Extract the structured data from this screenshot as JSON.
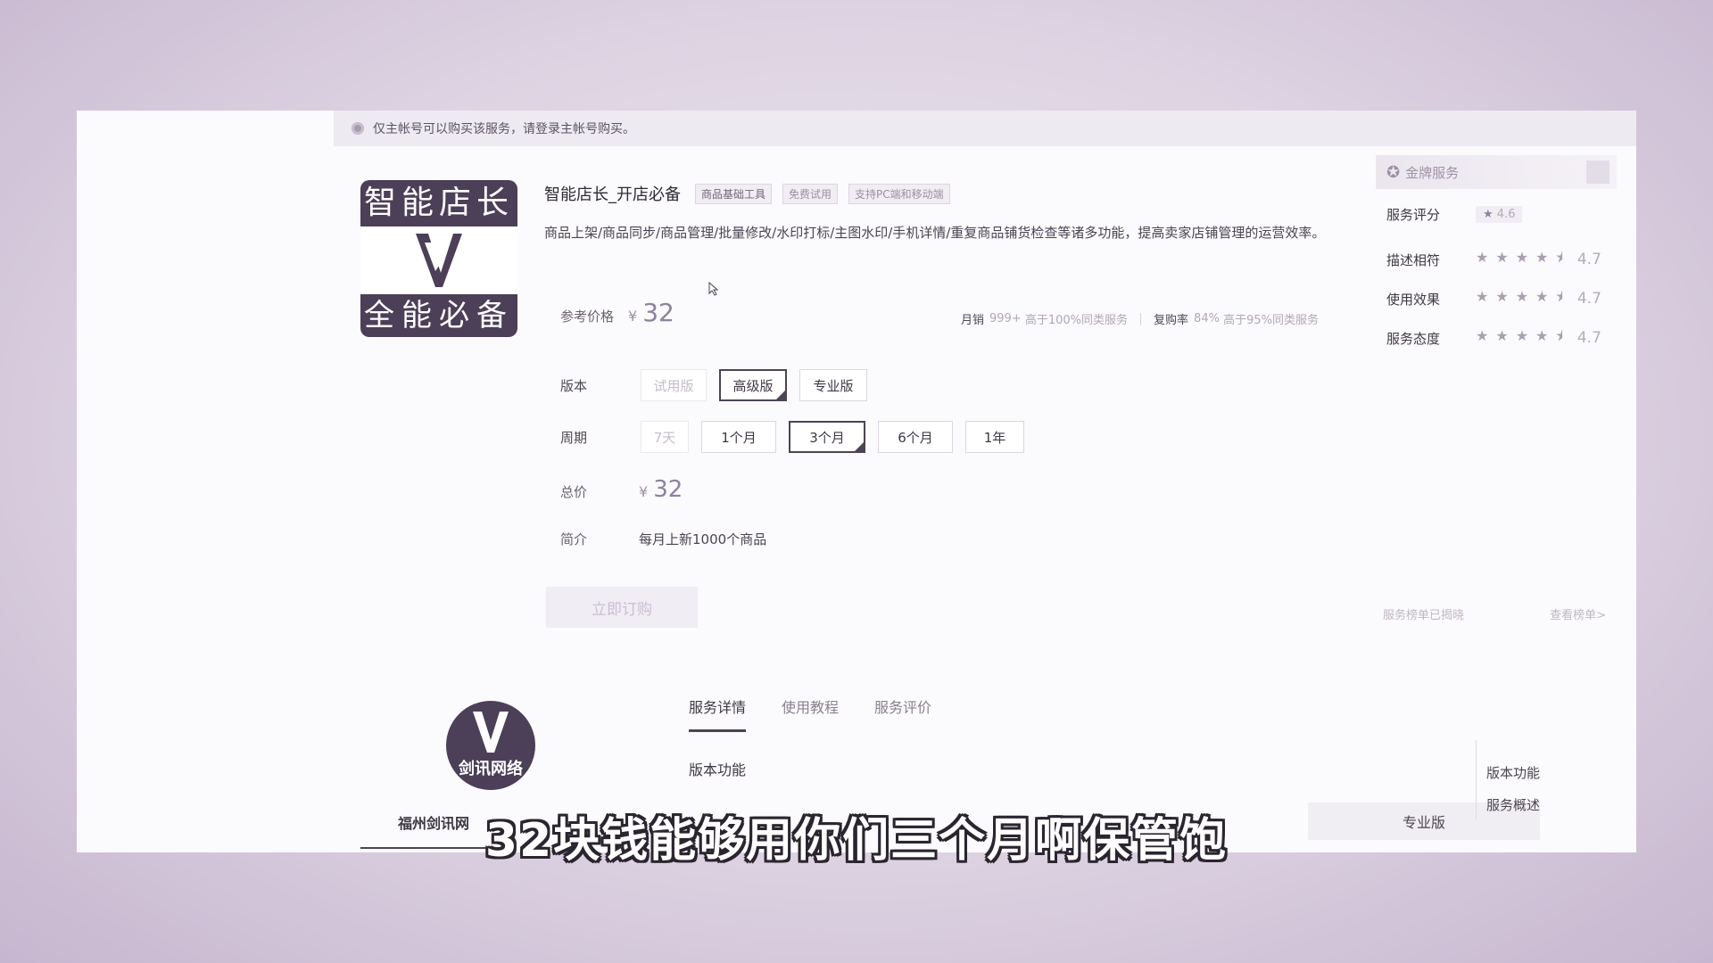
{
  "notice": "仅主帐号可以购买该服务，请登录主帐号购买。",
  "logo": {
    "top_text": "智能店长",
    "bottom_text": "全能必备"
  },
  "product": {
    "title": "智能店长_开店必备",
    "tags": [
      "商品基础工具",
      "免费试用",
      "支持PC端和移动端"
    ],
    "description": "商品上架/商品同步/商品管理/批量修改/水印打标/主图水印/手机详情/重复商品铺货检查等诸多功能，提高卖家店铺管理的运营效率。"
  },
  "price": {
    "label": "参考价格",
    "currency": "¥",
    "value": "32"
  },
  "sales": {
    "monthly_label": "月销",
    "monthly_value": "999+",
    "monthly_compare": "高于100%同类服务",
    "repurchase_label": "复购率",
    "repurchase_value": "84%",
    "repurchase_compare": "高于95%同类服务"
  },
  "version": {
    "label": "版本",
    "options": [
      "试用版",
      "高级版",
      "专业版"
    ],
    "selected": "高级版"
  },
  "period": {
    "label": "周期",
    "options": [
      "7天",
      "1个月",
      "3个月",
      "6个月",
      "1年"
    ],
    "selected": "3个月"
  },
  "total": {
    "label": "总价",
    "currency": "¥",
    "value": "32"
  },
  "intro": {
    "label": "简介",
    "text": "每月上新1000个商品"
  },
  "order_button": "立即订购",
  "side": {
    "gold_service": "金牌服务",
    "score_label": "服务评分",
    "score_value": "4.6",
    "ratings": [
      {
        "label": "描述相符",
        "value": "4.7"
      },
      {
        "label": "使用效果",
        "value": "4.7"
      },
      {
        "label": "服务态度",
        "value": "4.7"
      }
    ],
    "ranking_text": "服务榜单已揭晓",
    "ranking_link": "查看榜单>"
  },
  "company": {
    "logo_text": "剑讯网络",
    "name": "福州剑讯网"
  },
  "tabs": [
    "服务详情",
    "使用教程",
    "服务评价"
  ],
  "section_title": "版本功能",
  "pro_header": "专业版",
  "anchors": [
    "版本功能",
    "服务概述"
  ],
  "subtitle": "32块钱能够用你们三个月啊保管饱",
  "colors": {
    "accent": "#4c4355",
    "frame_bg": "#fbfafc",
    "backdrop": "#ddd3e2"
  }
}
